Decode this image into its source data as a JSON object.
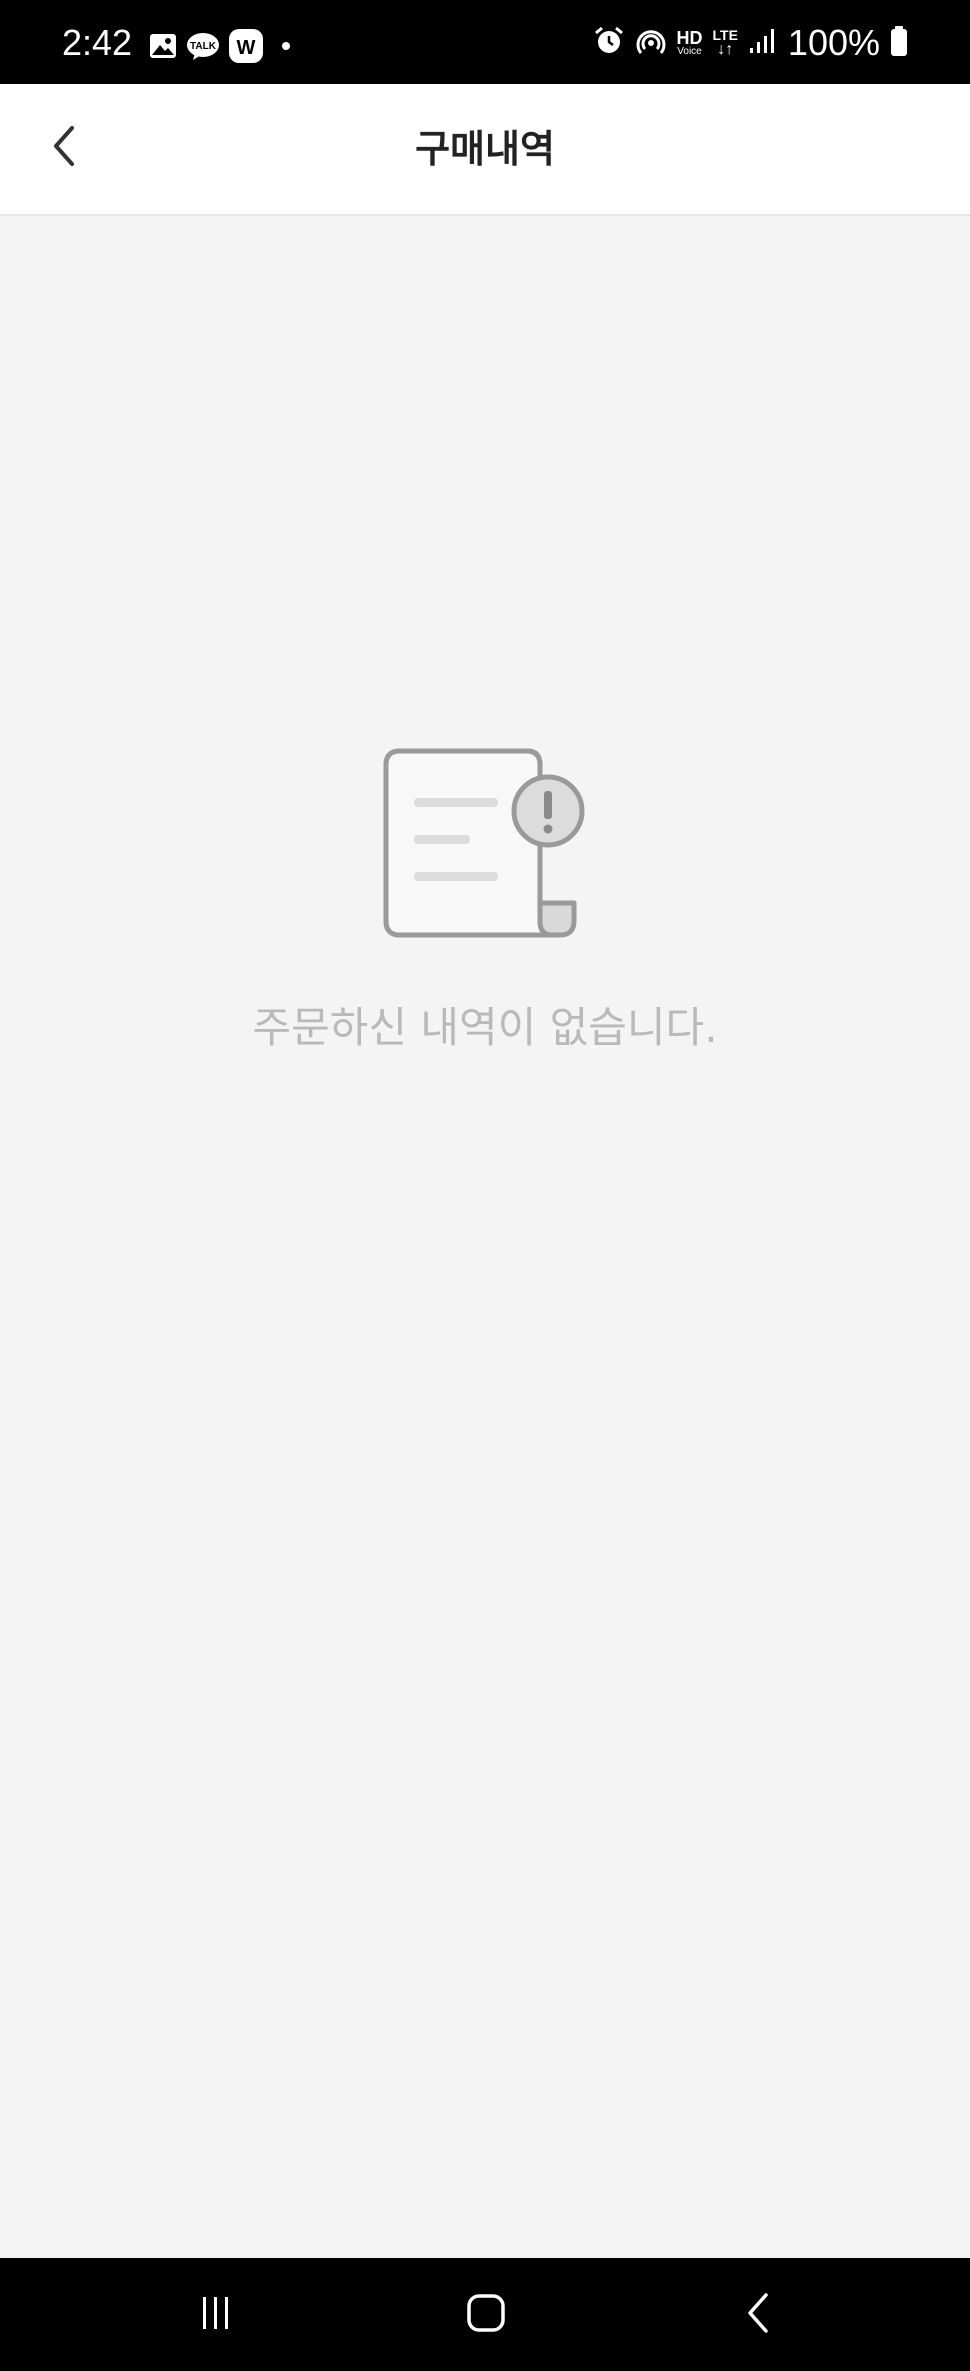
{
  "status_bar": {
    "time": "2:42",
    "battery": "100%",
    "network": "LTE",
    "hd_voice": "HD",
    "hd_voice_sub": "Voice",
    "notification_icons": [
      "gallery-icon",
      "kakaotalk-icon",
      "webtoon-icon",
      "dot-icon"
    ],
    "system_icons": [
      "alarm-icon",
      "hotspot-icon",
      "hd-voice-icon",
      "lte-icon",
      "signal-icon",
      "battery-icon"
    ],
    "talk_label": "TALK",
    "w_label": "W"
  },
  "header": {
    "title": "구매내역",
    "back_icon": "chevron-left-icon"
  },
  "empty_state": {
    "icon": "document-alert-icon",
    "message": "주문하신 내역이 없습니다."
  },
  "nav_bar": {
    "recent_apps_icon": "recent-apps-icon",
    "home_icon": "home-icon",
    "back_icon": "back-icon"
  },
  "colors": {
    "status_bar_bg": "#000000",
    "header_bg": "#ffffff",
    "page_bg": "#f4f4f4",
    "title_text": "#222222",
    "empty_text": "#b9b9b9",
    "icon_stroke": "#9a9a9a"
  }
}
